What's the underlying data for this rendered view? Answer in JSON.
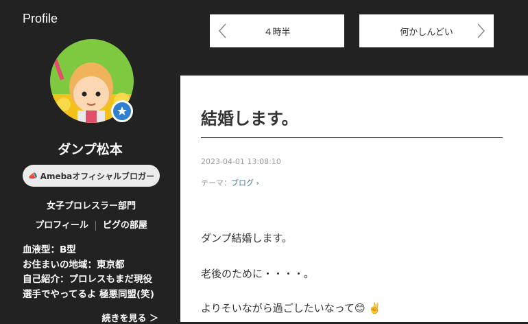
{
  "sidebar": {
    "heading": "Profile",
    "blogger_name": "ダンプ松本",
    "official_badge": "Amebaオフィシャルブロガー",
    "category": "女子プロレスラー部門",
    "links": [
      "プロフィール",
      "ピグの部屋"
    ],
    "info_lines": [
      "血液型：B型",
      "お住まいの地域：東京都",
      "自己紹介：プロレスもまだ現役",
      "選手でやってるよ 極悪同盟(笑)"
    ],
    "more_link": "続きを見る ＞"
  },
  "nav": {
    "prev_label": "４時半",
    "next_label": "何かしんどい"
  },
  "article": {
    "title": "結婚します。",
    "date": "2023-04-01 13:08:10",
    "theme_prefix": "テーマ：",
    "theme_link": "ブログ",
    "body": [
      "ダンプ結婚します。",
      "老後のために・・・・。",
      "よりそいながら過ごしたいなって😊 ✌️"
    ]
  },
  "colors": {
    "background": "#222222",
    "accent_blue": "#2f7fd0",
    "link_blue": "#3c6fa8"
  }
}
